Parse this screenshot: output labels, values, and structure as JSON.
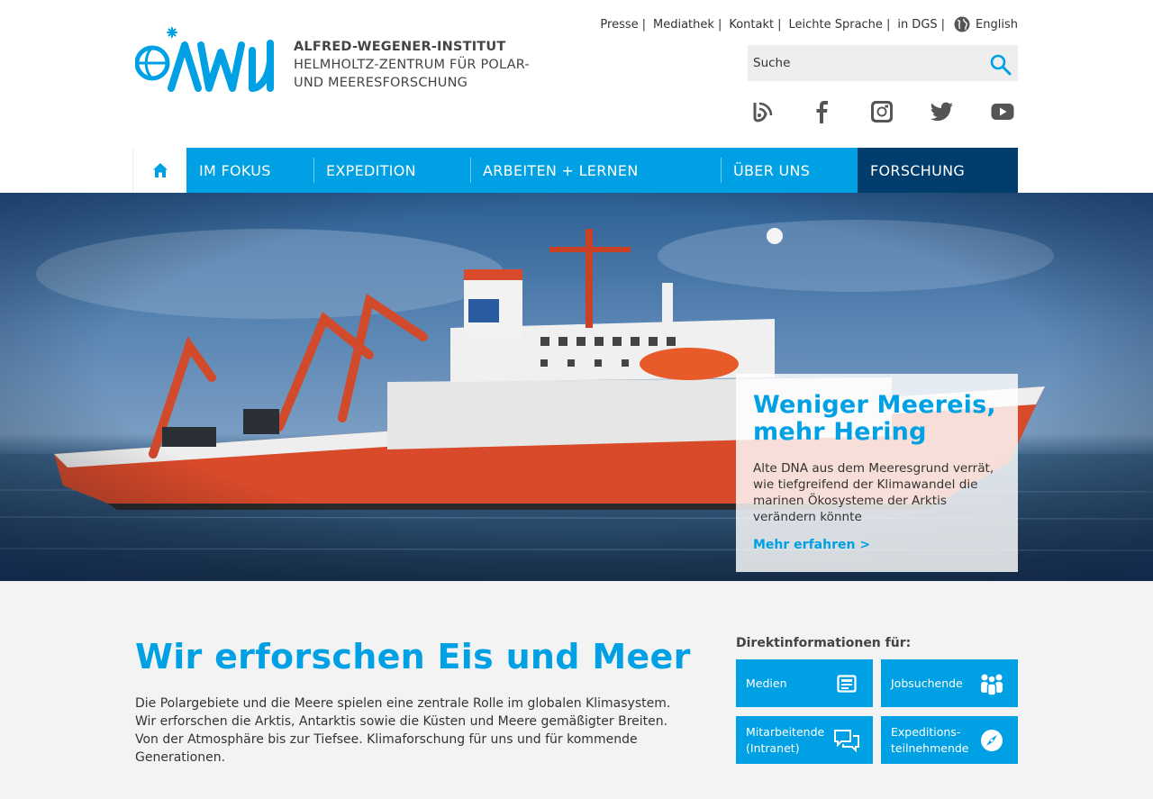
{
  "logo": {
    "line1": "ALFRED-WEGENER-INSTITUT",
    "line2": "HELMHOLTZ-ZENTRUM FÜR POLAR-",
    "line3": "UND MEERESFORSCHUNG"
  },
  "meta_nav": {
    "items": [
      "Presse",
      "Mediathek",
      "Kontakt",
      "Leichte Sprache",
      "in DGS"
    ],
    "separator": "|",
    "language": "English"
  },
  "search": {
    "placeholder": "Suche"
  },
  "social": [
    "blog-icon",
    "facebook-icon",
    "instagram-icon",
    "twitter-icon",
    "youtube-icon"
  ],
  "main_nav": {
    "items": [
      "IM FOKUS",
      "EXPEDITION",
      "ARBEITEN + LERNEN",
      "ÜBER UNS"
    ],
    "highlight": "FORSCHUNG"
  },
  "hero": {
    "title_line1": "Weniger Meereis,",
    "title_line2": "mehr Hering",
    "text": "Alte DNA aus dem Meeresgrund verrät, wie tiefgreifend der Klimawandel die marinen Ökosysteme der Arktis verändern könnte",
    "more": "Mehr erfahren >"
  },
  "intro": {
    "title": "Wir erforschen Eis und Meer",
    "text": "Die Polargebiete und die Meere spielen eine zentrale Rolle im globalen Klimasystem. Wir erforschen die Arktis, Antarktis sowie die Küsten und Meere gemäßigter Breiten. Von der Atmosphäre bis zur Tiefsee. Klimaforschung für uns und für kommende Generationen."
  },
  "direct": {
    "title": "Direktinformationen für:",
    "tiles": [
      {
        "line1": "Medien",
        "line2": "",
        "icon": "newspaper-icon"
      },
      {
        "line1": "Jobsuchende",
        "line2": "",
        "icon": "people-icon"
      },
      {
        "line1": "Mitarbeitende",
        "line2": "(Intranet)",
        "icon": "chat-icon"
      },
      {
        "line1": "Expeditions-",
        "line2": "teilnehmende",
        "icon": "compass-icon"
      }
    ]
  },
  "colors": {
    "brand": "#00a1e4",
    "dark": "#003c6c",
    "grey_bg": "#f3f3f3"
  }
}
